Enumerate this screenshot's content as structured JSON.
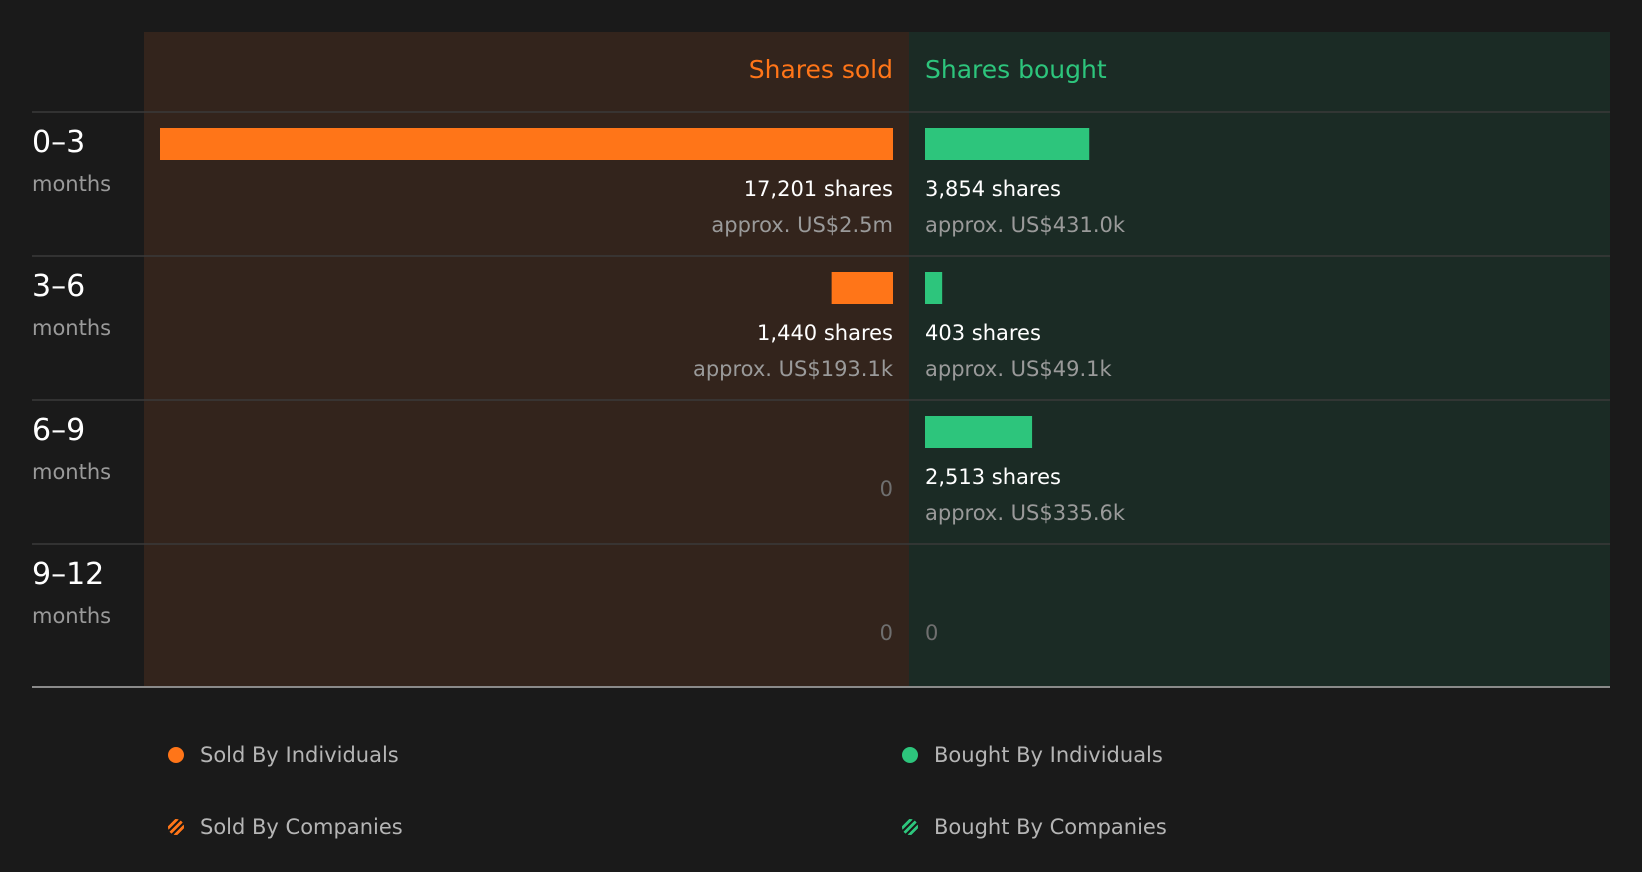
{
  "chart_data": {
    "type": "bar",
    "orientation": "horizontal-diverging",
    "columns": {
      "sold": "Shares sold",
      "bought": "Shares bought"
    },
    "rows": [
      {
        "period": "0–3",
        "unit": "months",
        "sold": {
          "shares": 17201,
          "label": "17,201 shares",
          "value": "approx. US$2.5m"
        },
        "bought": {
          "shares": 3854,
          "label": "3,854 shares",
          "value": "approx. US$431.0k"
        }
      },
      {
        "period": "3–6",
        "unit": "months",
        "sold": {
          "shares": 1440,
          "label": "1,440 shares",
          "value": "approx. US$193.1k"
        },
        "bought": {
          "shares": 403,
          "label": "403 shares",
          "value": "approx. US$49.1k"
        }
      },
      {
        "period": "6–9",
        "unit": "months",
        "sold": {
          "shares": 0,
          "label": "0",
          "value": ""
        },
        "bought": {
          "shares": 2513,
          "label": "2,513 shares",
          "value": "approx. US$335.6k"
        }
      },
      {
        "period": "9–12",
        "unit": "months",
        "sold": {
          "shares": 0,
          "label": "0",
          "value": ""
        },
        "bought": {
          "shares": 0,
          "label": "0",
          "value": ""
        }
      }
    ],
    "max_shares": 17201,
    "legend": [
      {
        "label": "Sold By Individuals",
        "color": "#ff7518",
        "pattern": "solid"
      },
      {
        "label": "Bought By Individuals",
        "color": "#2dc57c",
        "pattern": "solid"
      },
      {
        "label": "Sold By Companies",
        "color": "#ff7518",
        "pattern": "hatched"
      },
      {
        "label": "Bought By Companies",
        "color": "#2dc57c",
        "pattern": "hatched"
      }
    ],
    "colors": {
      "sold": "#ff7518",
      "bought": "#2dc57c",
      "sold_bg": "#33241c",
      "bought_bg": "#1b2b25",
      "background": "#1a1a1a"
    }
  }
}
